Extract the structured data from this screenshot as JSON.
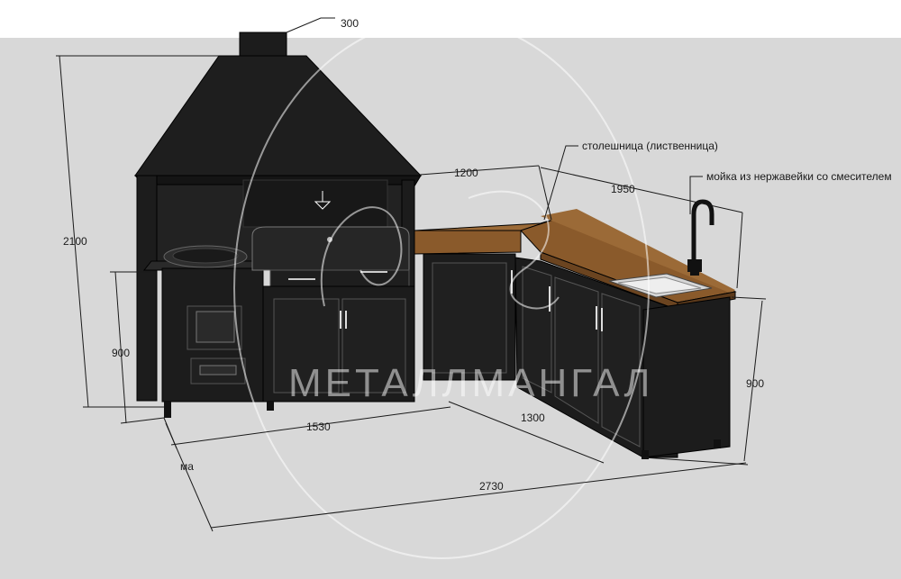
{
  "scene": {
    "colors": {
      "sky": "#ffffff",
      "floor": "#d8d8d8",
      "metal": "#1c1c1c",
      "metal_edge": "#000000",
      "counter_top": "#8a5a2b",
      "sink": "#dcdcdc"
    },
    "objects": [
      "grill-hood",
      "chimney",
      "stove-with-oven",
      "bbq-grill",
      "base-cabinets",
      "corner-counter",
      "sink",
      "mixer-faucet"
    ]
  },
  "dimensions": {
    "chimney_width": "300",
    "total_height": "2100",
    "counter_depth_left": "1200",
    "counter_depth_right": "1950",
    "cabinet_height_left": "900",
    "cabinet_height_right": "900",
    "front_length": "1530",
    "side_length": "1300",
    "overall_length": "2730"
  },
  "annotations": {
    "countertop": "столешница (лиственница)",
    "sink": "мойка из нержавейки со смесителем",
    "fragment": "ма"
  },
  "watermark": {
    "text": "МЕТАЛЛМАНГАЛ",
    "monogram": "MS"
  }
}
